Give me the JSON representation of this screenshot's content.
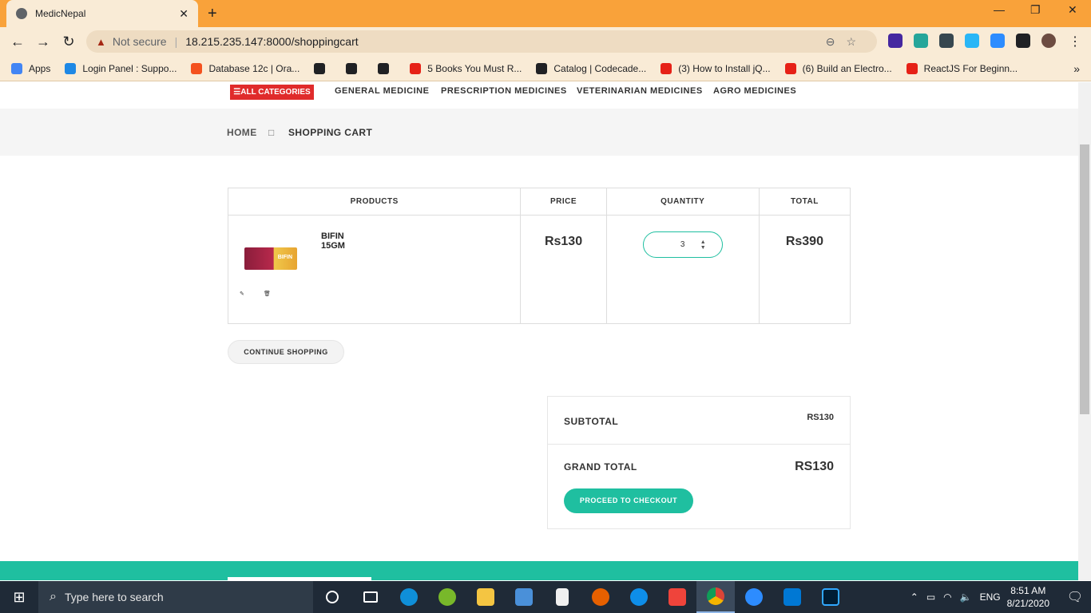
{
  "browser": {
    "tab_title": "MedicNepal",
    "tab_close": "✕",
    "new_tab": "+",
    "minimize": "—",
    "restore": "❐",
    "close": "✕",
    "not_secure": "Not secure",
    "url": "18.215.235.147:8000/shoppingcart",
    "bookmarks": [
      {
        "label": "Apps",
        "color": "#4285f4"
      },
      {
        "label": "Login Panel : Suppo...",
        "color": "#1e88e5"
      },
      {
        "label": "Database 12c | Ora...",
        "color": "#f4511e"
      },
      {
        "label": "",
        "color": "#202124"
      },
      {
        "label": "",
        "color": "#202124"
      },
      {
        "label": "",
        "color": "#202124"
      },
      {
        "label": "5 Books You Must R...",
        "color": "#e62117"
      },
      {
        "label": "Catalog | Codecade...",
        "color": "#202124"
      },
      {
        "label": "(3) How to Install jQ...",
        "color": "#e62117"
      },
      {
        "label": "(6) Build an Electro...",
        "color": "#e62117"
      },
      {
        "label": "ReactJS For Beginn...",
        "color": "#e62117"
      }
    ],
    "bookmarks_more": "»"
  },
  "site": {
    "menu": {
      "all_categories": "☰ALL CATEGORIES",
      "items": [
        "GENERAL MEDICINE",
        "PRESCRIPTION MEDICINES",
        "VETERINARIAN MEDICINES",
        "AGRO MEDICINES"
      ]
    },
    "breadcrumb": {
      "home": "HOME",
      "separator": "□",
      "current": "SHOPPING CART"
    },
    "cart": {
      "headers": [
        "PRODUCTS",
        "PRICE",
        "QUANTITY",
        "TOTAL"
      ],
      "item": {
        "name": "BIFIN 15GM",
        "image_label": "BIFIN",
        "price": "Rs130",
        "quantity": "3",
        "total": "Rs390",
        "edit_icon": "✎",
        "delete_icon": "🗑"
      }
    },
    "continue_shopping": "CONTINUE SHOPPING",
    "totals": {
      "subtotal_label": "SUBTOTAL",
      "subtotal_value": "RS130",
      "grand_total_label": "GRAND TOTAL",
      "grand_total_value": "RS130",
      "checkout": "PROCEED TO CHECKOUT"
    }
  },
  "taskbar": {
    "search_placeholder": "Type here to search",
    "language": "ENG",
    "time": "8:51 AM",
    "date": "8/21/2020"
  },
  "colors": {
    "accent": "#1fbfa0",
    "category_red": "#e02b2b",
    "browser_orange": "#f9a23a"
  }
}
